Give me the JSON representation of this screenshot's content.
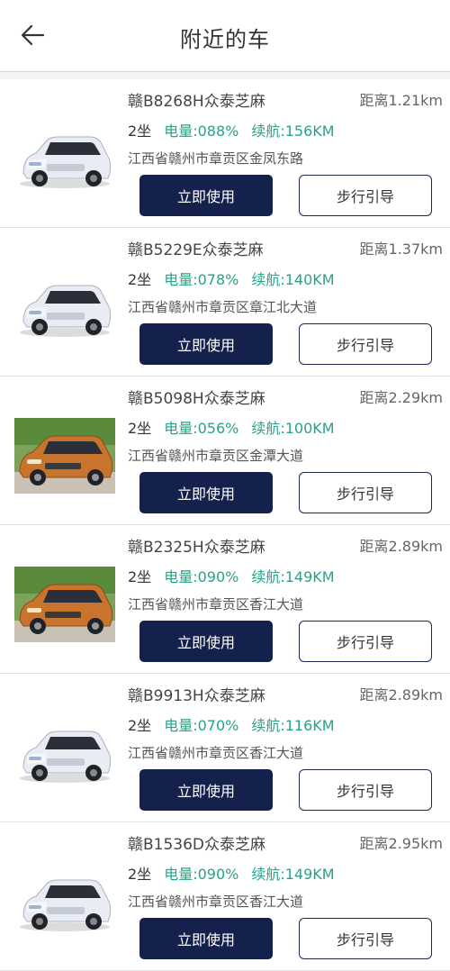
{
  "header": {
    "title": "附近的车"
  },
  "colors": {
    "primary_button": "#15214d",
    "accent_text": "#27a38a"
  },
  "cars": [
    {
      "plate": "赣B8268H众泰芝麻",
      "distance": "距离1.21km",
      "seats": "2坐",
      "battery": "电量:088%",
      "range": "续航:156KM",
      "address": "江西省赣州市章贡区金凤东路",
      "use_label": "立即使用",
      "walk_label": "步行引导",
      "car_color": "white"
    },
    {
      "plate": "赣B5229E众泰芝麻",
      "distance": "距离1.37km",
      "seats": "2坐",
      "battery": "电量:078%",
      "range": "续航:140KM",
      "address": "江西省赣州市章贡区章江北大道",
      "use_label": "立即使用",
      "walk_label": "步行引导",
      "car_color": "white"
    },
    {
      "plate": "赣B5098H众泰芝麻",
      "distance": "距离2.29km",
      "seats": "2坐",
      "battery": "电量:056%",
      "range": "续航:100KM",
      "address": "江西省赣州市章贡区金潭大道",
      "use_label": "立即使用",
      "walk_label": "步行引导",
      "car_color": "orange"
    },
    {
      "plate": "赣B2325H众泰芝麻",
      "distance": "距离2.89km",
      "seats": "2坐",
      "battery": "电量:090%",
      "range": "续航:149KM",
      "address": "江西省赣州市章贡区香江大道",
      "use_label": "立即使用",
      "walk_label": "步行引导",
      "car_color": "orange"
    },
    {
      "plate": "赣B9913H众泰芝麻",
      "distance": "距离2.89km",
      "seats": "2坐",
      "battery": "电量:070%",
      "range": "续航:116KM",
      "address": "江西省赣州市章贡区香江大道",
      "use_label": "立即使用",
      "walk_label": "步行引导",
      "car_color": "white"
    },
    {
      "plate": "赣B1536D众泰芝麻",
      "distance": "距离2.95km",
      "seats": "2坐",
      "battery": "电量:090%",
      "range": "续航:149KM",
      "address": "江西省赣州市章贡区香江大道",
      "use_label": "立即使用",
      "walk_label": "步行引导",
      "car_color": "white"
    }
  ]
}
